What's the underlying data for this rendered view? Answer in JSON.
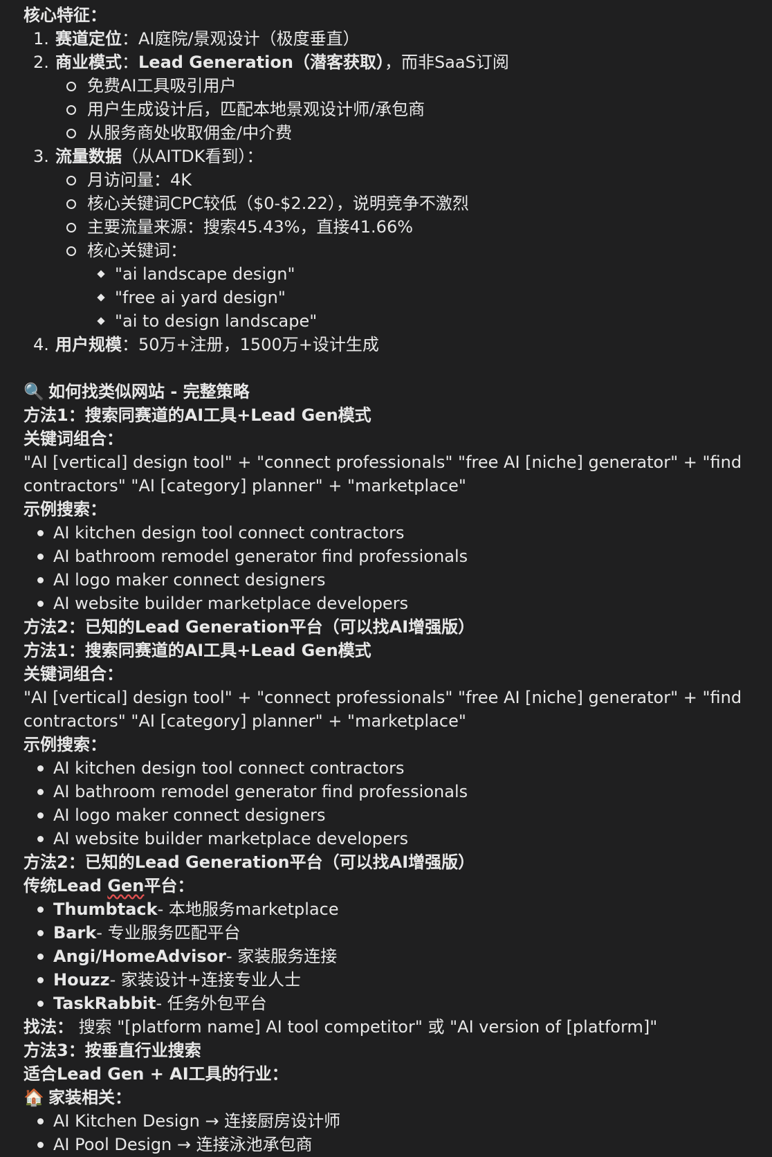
{
  "core": {
    "heading": "核心特征：",
    "item1": {
      "num": "1.",
      "label": "赛道定位",
      "text": "：AI庭院/景观设计（极度垂直）"
    },
    "item2": {
      "num": "2.",
      "label": "商业模式",
      "sep": "：",
      "bold": "Lead Generation（潜客获取）",
      "text": "，而非SaaS订阅",
      "subs": [
        "免费AI工具吸引用户",
        "用户生成设计后，匹配本地景观设计师/承包商",
        "从服务商处收取佣金/中介费"
      ]
    },
    "item3": {
      "num": "3.",
      "label": "流量数据",
      "text": "（从AITDK看到）：",
      "subs": [
        "月访问量：4K",
        "核心关键词CPC较低（$0-$2.22），说明竞争不激烈",
        "主要流量来源：搜索45.43%，直接41.66%",
        "核心关键词："
      ],
      "keywords": [
        "\"ai landscape design\"",
        "\"free ai yard design\"",
        "\"ai to design landscape\""
      ]
    },
    "item4": {
      "num": "4.",
      "label": "用户规模",
      "text": "：50万+注册，1500万+设计生成"
    }
  },
  "strategy": {
    "icon": "magnifier-icon",
    "heading_emoji": "🔍",
    "heading": "如何找类似网站 - 完整策略",
    "block": {
      "method1": "方法1：搜索同赛道的AI工具+Lead Gen模式",
      "kw_heading": "关键词组合：",
      "kw_text": "\"AI [vertical] design tool\" + \"connect professionals\" \"free AI [niche] generator\" + \"find contractors\" \"AI [category] planner\" + \"marketplace\"",
      "examples_heading": "示例搜索：",
      "examples": [
        "AI kitchen design tool connect contractors",
        "AI bathroom remodel generator find professionals",
        "AI logo maker connect designers",
        "AI website builder marketplace developers"
      ],
      "method2": "方法2：已知的Lead Generation平台（可以找AI增强版）"
    },
    "traditional_heading_pre": "传统Lead ",
    "traditional_heading_gen": "Gen",
    "traditional_heading_post": "平台：",
    "platforms": [
      {
        "name": "Thumbtack",
        "desc": " - 本地服务marketplace"
      },
      {
        "name": "Bark",
        "desc": " - 专业服务匹配平台"
      },
      {
        "name": "Angi/HomeAdvisor",
        "desc": " - 家装服务连接"
      },
      {
        "name": "Houzz",
        "desc": " - 家装设计+连接专业人士"
      },
      {
        "name": "TaskRabbit",
        "desc": " - 任务外包平台"
      }
    ],
    "find_label": "找法：",
    "find_text": " 搜索 \"[platform name] AI tool competitor\" 或 \"AI version of [platform]\"",
    "method3": "方法3：按垂直行业搜索",
    "industries_heading": "适合Lead Gen + AI工具的行业：",
    "home_emoji": "🏠",
    "home_heading": "家装相关：",
    "home_items": [
      "AI Kitchen Design → 连接厨房设计师",
      "AI Pool Design → 连接泳池承包商"
    ]
  }
}
